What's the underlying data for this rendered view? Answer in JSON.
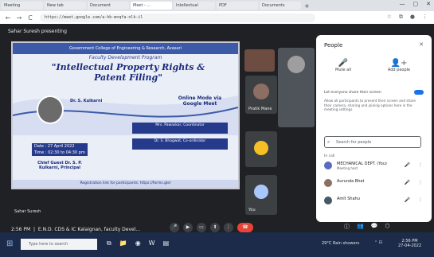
{
  "browser": {
    "tabs": [
      {
        "label": "Meeting"
      },
      {
        "label": "New tab"
      },
      {
        "label": "Document"
      },
      {
        "label": "Meet - ..."
      },
      {
        "label": "Intellectual"
      },
      {
        "label": "PDF"
      },
      {
        "label": "Documents"
      }
    ],
    "url": "https://meet.google.com/a-hb-mnqfa-nlk-il",
    "controls": {
      "back": "←",
      "forward": "→",
      "reload": "C",
      "minimize": "—",
      "maximize": "▢",
      "close": "✕"
    }
  },
  "meet": {
    "presenting_label": "Sahar Suresh presenting",
    "presenter_bottom": "Sahar Suresh",
    "footer_time": "2:56 PM",
    "footer_title": "E.N.D. CDS & IC Kalaignan, faculty Devel...",
    "slide": {
      "header": "Government College of Engineering & Research, Avasari",
      "subtitle": "Faculty Development Program",
      "title": "\"Intellectual Property Rights & Patent Filing\"",
      "speaker": "Dr. S. Kulkarni",
      "mode": "Online Mode via Google Meet",
      "box1": "Mrs. Pawaskar, Coordinator",
      "box2": "Dr. S. Bhagwat, Co-ordinator",
      "date_line1": "Date : 27 April 2022",
      "date_line2": "Time : 02:30 to 04:30 pm",
      "chief": "Chief Guest Dr. S. P. Kulkarni, Principal",
      "footer": "Registration link for participants: https://forms.gle/"
    },
    "tiles": [
      {
        "name": ""
      },
      {
        "name": "Pratik Mane"
      },
      {
        "name": ""
      },
      {
        "name": "You"
      }
    ]
  },
  "people": {
    "title": "People",
    "close": "✕",
    "actions": [
      {
        "label": "Mute all",
        "icon": "🎤"
      },
      {
        "label": "Add people",
        "icon": "👤+"
      }
    ],
    "lock_title": "Let everyone share their screen",
    "lock_desc": "Allow all participants to present their screen and share their camera, sharing and joining options here in the meeting settings",
    "search_placeholder": "Search for people",
    "section": "In call",
    "list": [
      {
        "name": "MECHANICAL DEPT. (You)",
        "sub": "Meeting host",
        "color": "#5c6bc0"
      },
      {
        "name": "Aurunda Bhat",
        "sub": "",
        "color": "#8d6e63"
      },
      {
        "name": "Amit Shahu",
        "sub": "",
        "color": "#455a64"
      }
    ]
  },
  "taskbar": {
    "search": "Type here to search",
    "weather": "29°C Rain showers",
    "clock_time": "2:56 PM",
    "clock_date": "27-04-2022"
  }
}
